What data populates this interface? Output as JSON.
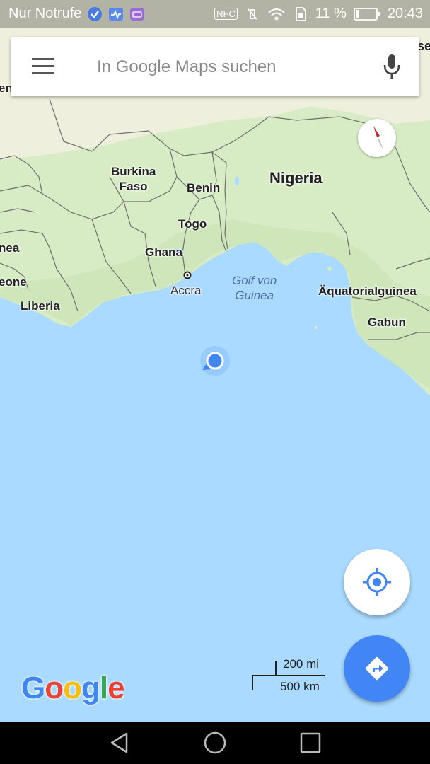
{
  "status_bar": {
    "carrier": "Nur Notrufe",
    "nfc": "NFC",
    "battery": "11 %",
    "time": "20:43"
  },
  "search": {
    "placeholder": "In Google Maps suchen"
  },
  "map": {
    "labels": {
      "burkina_faso": "Burkina\nFaso",
      "benin": "Benin",
      "nigeria": "Nigeria",
      "togo": "Togo",
      "ghana": "Ghana",
      "guinea_fragment": "nea",
      "leone_fragment": "eone",
      "accra": "Accra",
      "gulf": "Golf von\nGuinea",
      "equatorial_guinea": "Äquatorialguinea",
      "liberia": "Liberia",
      "gabon": "Gabun",
      "left_edge_fragment": "en",
      "right_edge_fragment": "se"
    },
    "colors": {
      "water": "#aadaff",
      "land": "#d7ecc4",
      "sand": "#f0eedc",
      "border": "#707070",
      "location_dot": "#4285f4"
    }
  },
  "scale": {
    "imperial": "200 mi",
    "metric": "500 km"
  },
  "logo": {
    "text": [
      "G",
      "o",
      "o",
      "g",
      "l",
      "e"
    ],
    "colors": [
      "#4285f4",
      "#ea4335",
      "#fbbc05",
      "#4285f4",
      "#34a853",
      "#ea4335"
    ]
  },
  "icons": {
    "menu": "menu-icon",
    "mic": "mic-icon",
    "compass": "compass-icon",
    "my_location": "my-location-icon",
    "directions": "directions-icon",
    "back": "back-icon",
    "home": "home-icon",
    "recents": "recents-icon"
  }
}
